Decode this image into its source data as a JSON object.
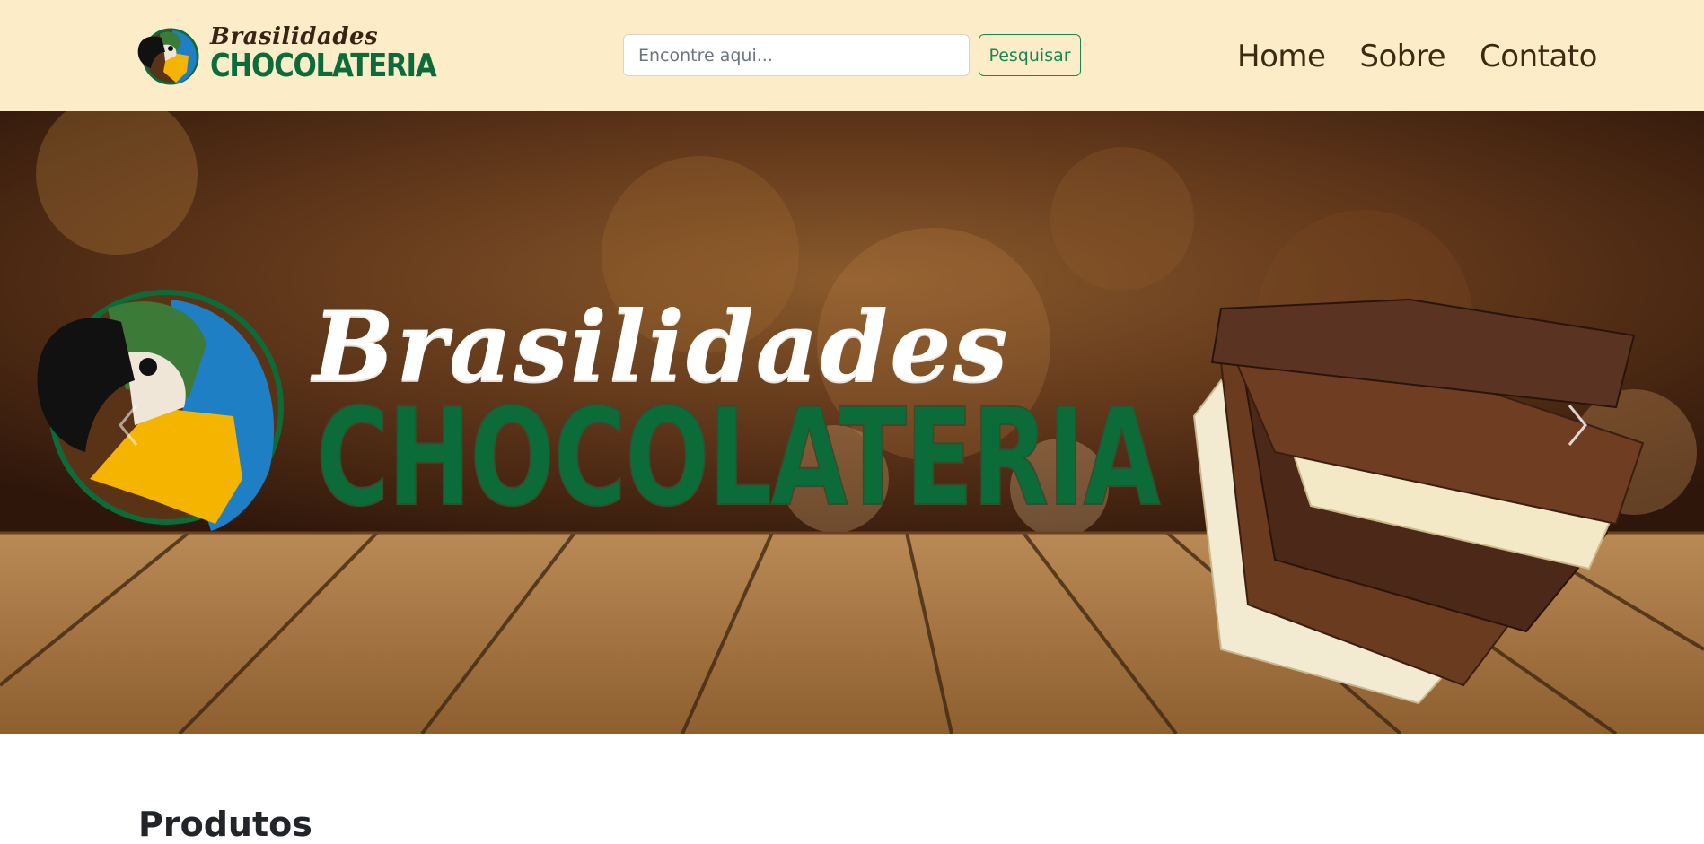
{
  "header": {
    "brand": {
      "script_text": "Brasilidades",
      "block_text": "CHOCOLATERIA",
      "logo_icon": "macaw-parrot-logo-icon"
    },
    "search": {
      "placeholder": "Encontre aqui...",
      "value": "",
      "button_label": "Pesquisar"
    },
    "nav": [
      {
        "label": "Home"
      },
      {
        "label": "Sobre"
      },
      {
        "label": "Contato"
      }
    ]
  },
  "carousel": {
    "slide": {
      "script_text": "Brasilidades",
      "block_text": "CHOCOLATERIA"
    },
    "prev_icon": "chevron-left-icon",
    "next_icon": "chevron-right-icon"
  },
  "main": {
    "section_title": "Produtos"
  },
  "colors": {
    "header_bg": "#fdecc8",
    "brand_green": "#0b6c3a",
    "success": "#198754",
    "nav_text": "#3d2a10"
  }
}
